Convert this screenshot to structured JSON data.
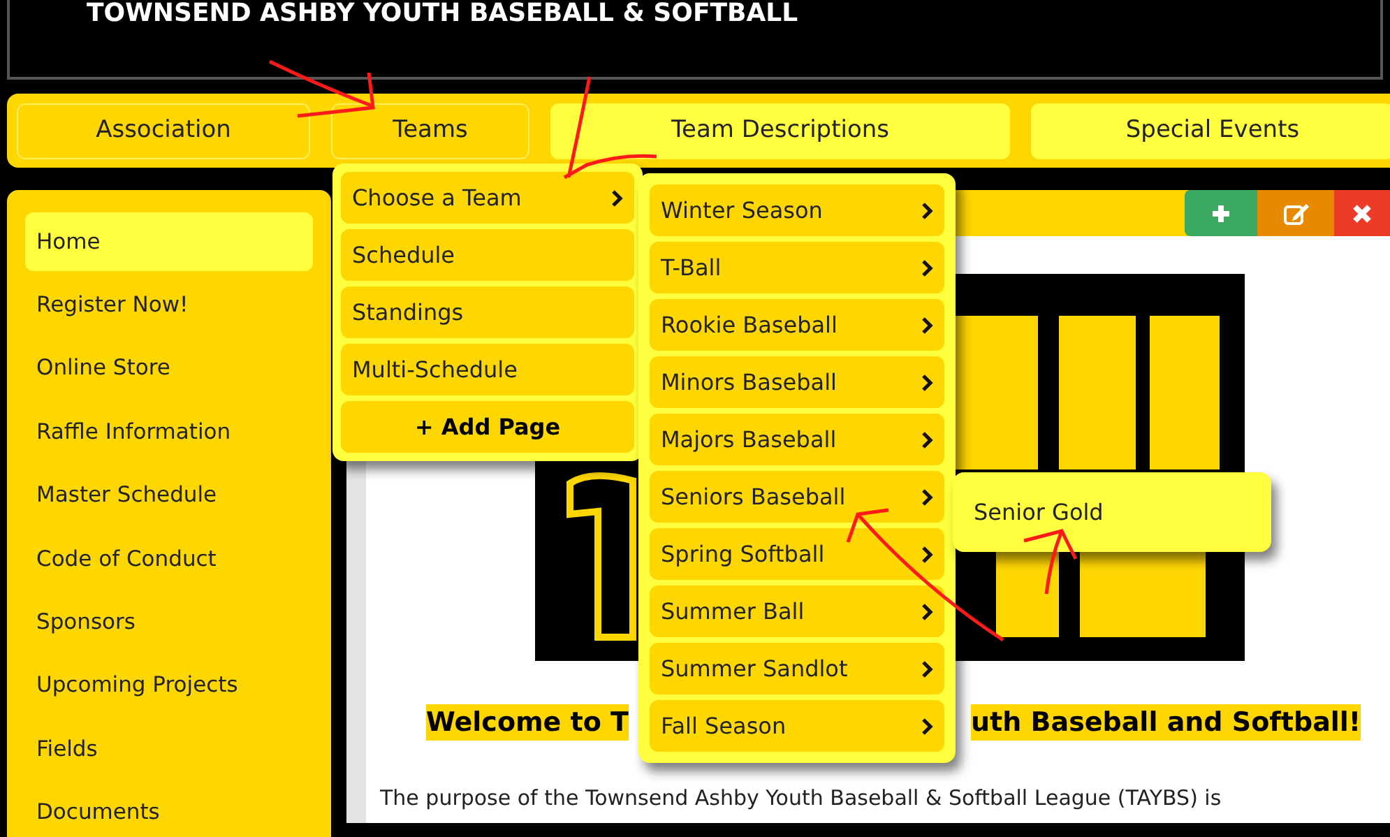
{
  "header": {
    "title": "TOWNSEND ASHBY YOUTH BASEBALL & SOFTBALL"
  },
  "nav_tabs": [
    {
      "label": "Association",
      "kind": "dark"
    },
    {
      "label": "Teams",
      "kind": "dark"
    },
    {
      "label": "Team Descriptions",
      "kind": "light"
    },
    {
      "label": "Special Events",
      "kind": "light"
    }
  ],
  "sidebar": {
    "items": [
      {
        "label": "Home",
        "selected": true
      },
      {
        "label": "Register Now!",
        "selected": false
      },
      {
        "label": "Online Store",
        "selected": false
      },
      {
        "label": "Raffle Information",
        "selected": false
      },
      {
        "label": "Master Schedule",
        "selected": false
      },
      {
        "label": "Code of Conduct",
        "selected": false
      },
      {
        "label": "Sponsors",
        "selected": false
      },
      {
        "label": "Upcoming Projects",
        "selected": false
      },
      {
        "label": "Fields",
        "selected": false
      },
      {
        "label": "Documents",
        "selected": false
      }
    ]
  },
  "toolbar": {
    "buttons": [
      {
        "kind": "add"
      },
      {
        "kind": "edit"
      },
      {
        "kind": "delete"
      }
    ]
  },
  "content": {
    "heading_left": "Welcome to T",
    "heading_right": "uth Baseball and Softball!",
    "paragraph": "The purpose of the Townsend Ashby Youth Baseball & Softball League (TAYBS) is"
  },
  "teams_menu": {
    "items": [
      {
        "label": "Choose a Team",
        "kind": "submenu"
      },
      {
        "label": "Schedule",
        "kind": "link"
      },
      {
        "label": "Standings",
        "kind": "link"
      },
      {
        "label": "Multi-Schedule",
        "kind": "link"
      },
      {
        "label": "+ Add Page",
        "kind": "add"
      }
    ]
  },
  "team_submenu": {
    "items": [
      {
        "label": "Winter Season"
      },
      {
        "label": "T-Ball"
      },
      {
        "label": "Rookie Baseball"
      },
      {
        "label": "Minors Baseball"
      },
      {
        "label": "Majors Baseball"
      },
      {
        "label": "Seniors Baseball"
      },
      {
        "label": "Spring Softball"
      },
      {
        "label": "Summer Ball"
      },
      {
        "label": "Summer Sandlot"
      },
      {
        "label": "Fall Season"
      }
    ]
  },
  "seniors_submenu": {
    "items": [
      {
        "label": "Senior Gold"
      }
    ]
  }
}
